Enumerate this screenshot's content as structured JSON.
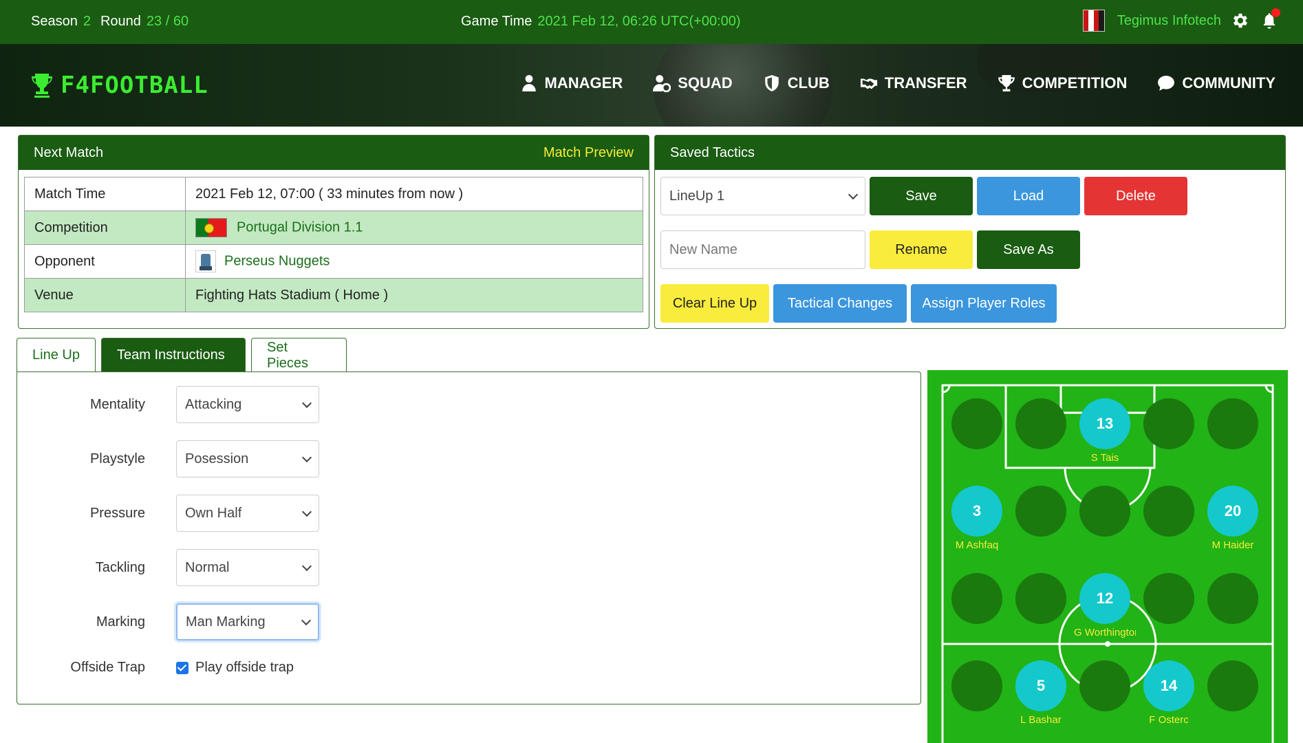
{
  "topbar": {
    "season_label": "Season",
    "season_value": "2",
    "round_label": "Round",
    "round_value": "23 / 60",
    "game_time_label": "Game Time",
    "game_time_value": "2021 Feb 12, 06:26 UTC(+00:00)",
    "club_name": "Tegimus Infotech"
  },
  "brand": {
    "name": "F4FOOTBALL"
  },
  "nav": {
    "items": [
      {
        "label": "MANAGER",
        "icon": "manager-icon"
      },
      {
        "label": "SQUAD",
        "icon": "squad-icon"
      },
      {
        "label": "CLUB",
        "icon": "shield-icon"
      },
      {
        "label": "TRANSFER",
        "icon": "handshake-icon"
      },
      {
        "label": "COMPETITION",
        "icon": "trophy-icon"
      },
      {
        "label": "COMMUNITY",
        "icon": "chat-icon"
      }
    ]
  },
  "next_match": {
    "title": "Next Match",
    "preview_link": "Match Preview",
    "rows": {
      "match_time": {
        "label": "Match Time",
        "value": "2021 Feb 12, 07:00 ( 33 minutes from now )"
      },
      "competition": {
        "label": "Competition",
        "value": "Portugal Division 1.1"
      },
      "opponent": {
        "label": "Opponent",
        "value": "Perseus Nuggets"
      },
      "venue": {
        "label": "Venue",
        "value": "Fighting Hats Stadium ( Home )"
      }
    }
  },
  "saved_tactics": {
    "title": "Saved Tactics",
    "selected_lineup": "LineUp 1",
    "save": "Save",
    "load": "Load",
    "delete": "Delete",
    "new_name_placeholder": "New Name",
    "rename": "Rename",
    "save_as": "Save As",
    "clear_lineup": "Clear Line Up",
    "tactical_changes": "Tactical Changes",
    "assign_roles": "Assign Player Roles"
  },
  "tabs": {
    "lineup": "Line Up",
    "team_instructions": "Team Instructions",
    "set_pieces": "Set Pieces"
  },
  "instructions": {
    "mentality": {
      "label": "Mentality",
      "value": "Attacking"
    },
    "playstyle": {
      "label": "Playstyle",
      "value": "Posession"
    },
    "pressure": {
      "label": "Pressure",
      "value": "Own Half"
    },
    "tackling": {
      "label": "Tackling",
      "value": "Normal"
    },
    "marking": {
      "label": "Marking",
      "value": "Man Marking"
    },
    "offside": {
      "label": "Offside Trap",
      "checkbox_label": "Play offside trap",
      "checked": true
    }
  },
  "pitch": {
    "players": [
      {
        "number": "13",
        "name": "S Tais"
      },
      {
        "number": "3",
        "name": "M Ashfaq"
      },
      {
        "number": "20",
        "name": "M Haider"
      },
      {
        "number": "12",
        "name": "G Worthington"
      },
      {
        "number": "5",
        "name": "L Bashar"
      },
      {
        "number": "14",
        "name": "F Osterc"
      }
    ]
  }
}
